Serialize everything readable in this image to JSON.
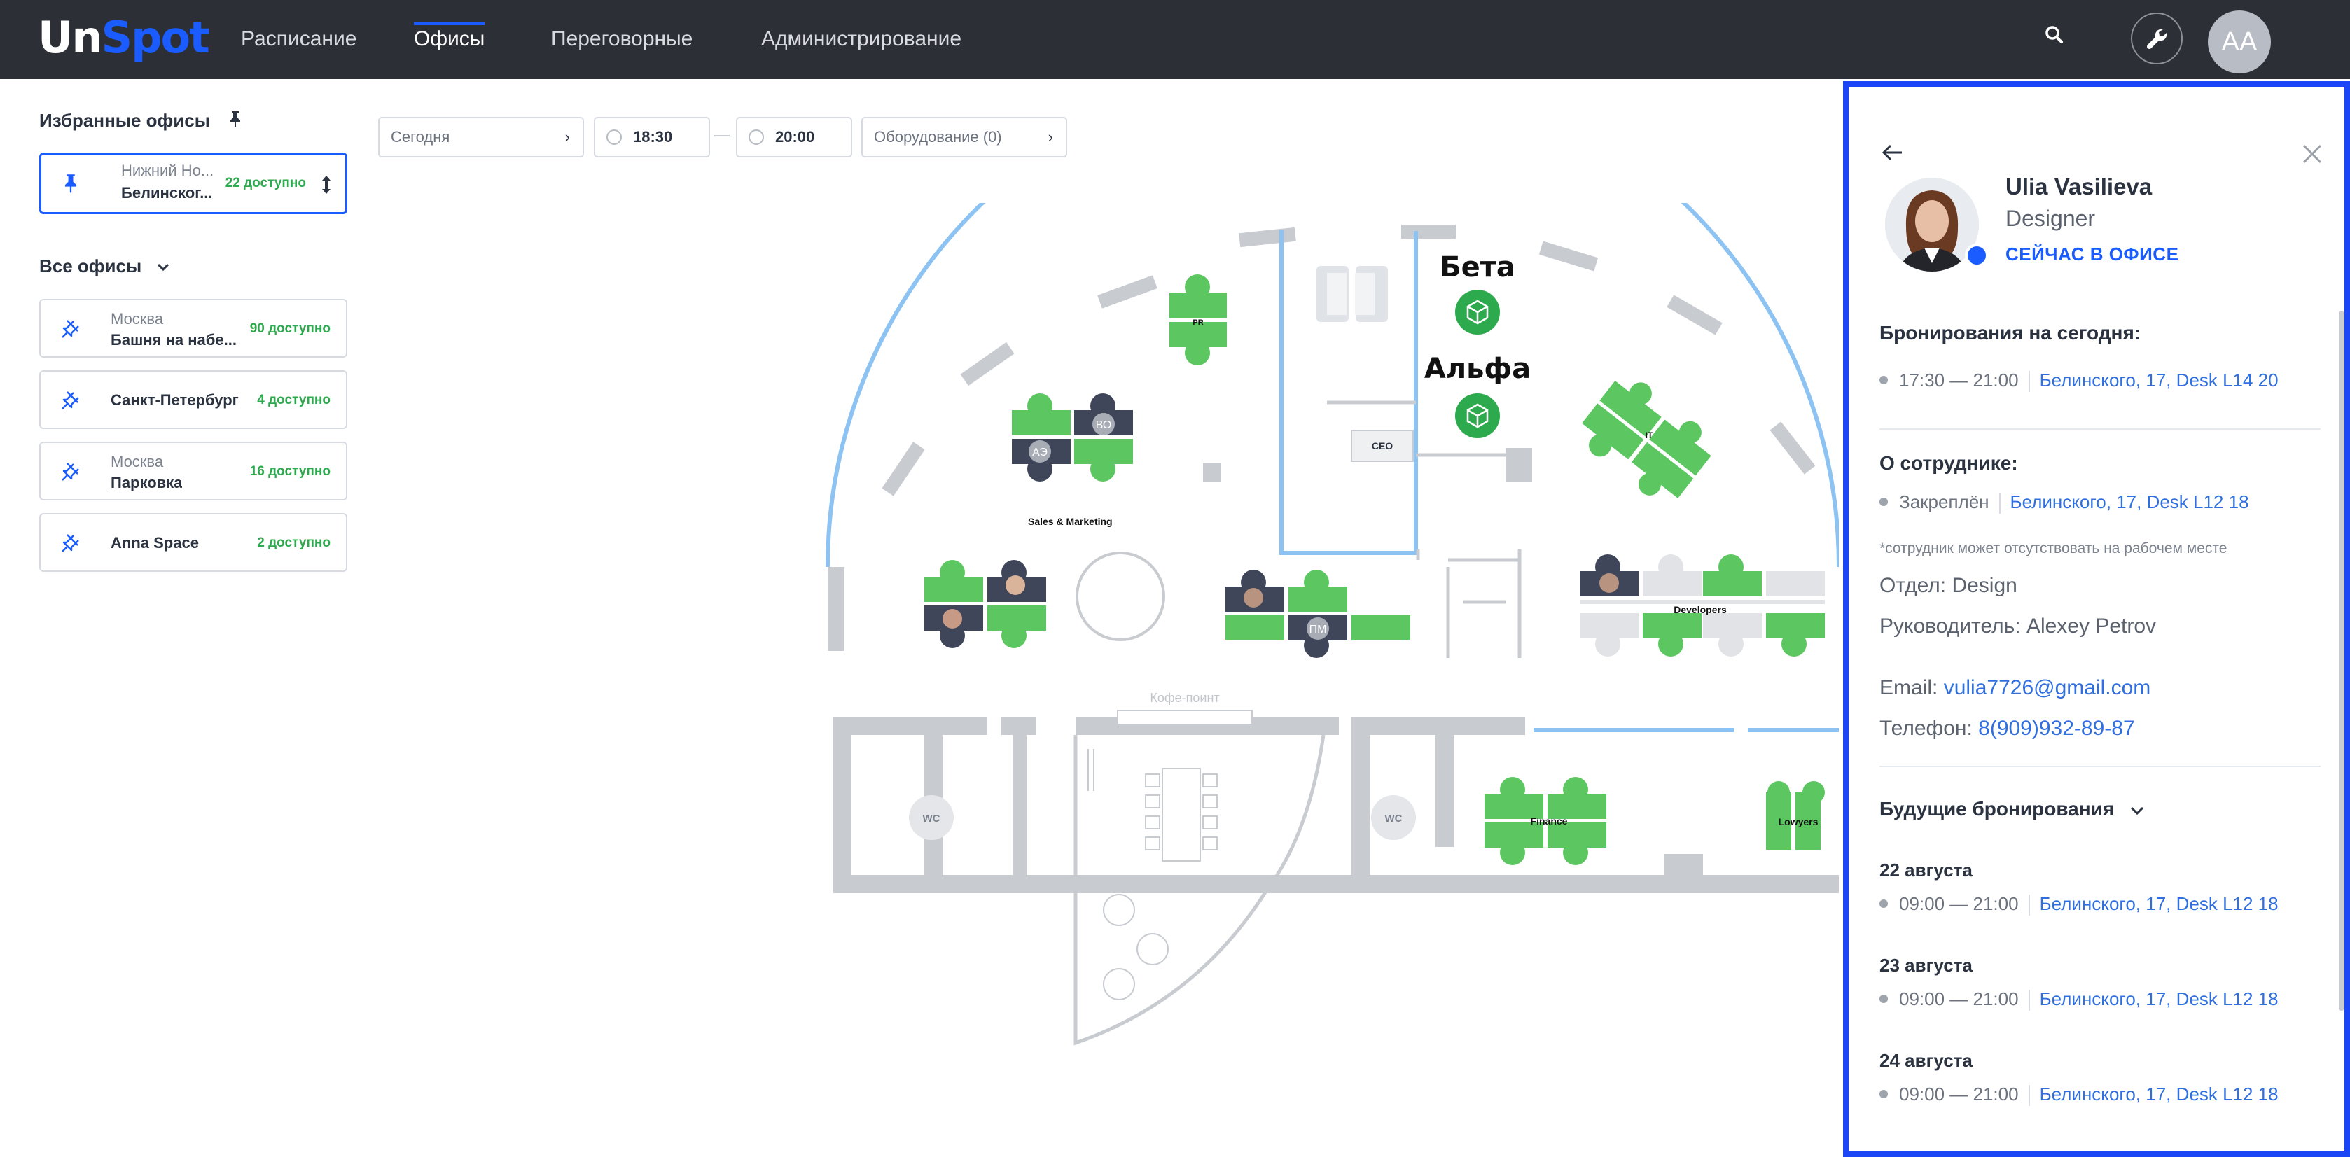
{
  "app": {
    "logo_un": "Un",
    "logo_spot": "Spot",
    "colors": {
      "accent": "#1a5cff",
      "topbar": "#2c2f36",
      "available": "#2eaa4e",
      "desk_free": "#5cc760",
      "desk_taken": "#3f4659",
      "wall": "#c8ccd1",
      "glass": "#8cc3f2",
      "panel_border": "#1a46f5"
    }
  },
  "nav": {
    "items": [
      {
        "label": "Расписание"
      },
      {
        "label": "Офисы"
      },
      {
        "label": "Переговорные"
      },
      {
        "label": "Администрирование"
      }
    ],
    "active_index": 1,
    "user_initials": "AA",
    "icons": {
      "search": "search-icon",
      "tools": "wrench-icon"
    }
  },
  "sidebar": {
    "favorites_title": "Избранные офисы",
    "favorites": [
      {
        "city": "Нижний Но...",
        "name": "Белинског...",
        "available": "22 доступно"
      }
    ],
    "all_title": "Все офисы",
    "offices": [
      {
        "city": "Москва",
        "name": "Башня на набе...",
        "available": "90 доступно"
      },
      {
        "city": "",
        "name": "Санкт-Петербург",
        "available": "4 доступно"
      },
      {
        "city": "Москва",
        "name": "Парковка",
        "available": "16 доступно"
      },
      {
        "city": "",
        "name": "Anna Space",
        "available": "2 доступно"
      }
    ]
  },
  "filters": {
    "date": "Сегодня",
    "time_from": "18:30",
    "time_to": "20:00",
    "separator": "—",
    "equipment": "Оборудование (0)"
  },
  "map": {
    "rooms": {
      "beta": "Бета",
      "alpha": "Альфа",
      "coffee": "Кофе-поинт",
      "wc": "WC",
      "ceo": "CEO",
      "pr": "PR",
      "it": "IT",
      "sales": "Sales & Marketing",
      "developers": "Developers",
      "finance": "Finance",
      "lowyers": "Lowyers"
    },
    "desk_initials": {
      "bo": "ВО",
      "az": "АЭ",
      "pm": "ПМ"
    }
  },
  "profile": {
    "name": "Ulia Vasilieva",
    "role": "Designer",
    "status": "СЕЙЧАС В ОФИСЕ",
    "today_title": "Бронирования на сегодня:",
    "today": {
      "time": "17:30 — 21:00",
      "place": "Белинского, 17, Desk L14 20"
    },
    "about_title": "О сотруднике:",
    "pinned": {
      "label": "Закреплён",
      "place": "Белинского, 17, Desk L12 18"
    },
    "note": "*сотрудник может отсутствовать на рабочем месте",
    "department": "Отдел: Design",
    "manager": "Руководитель: Alexey Petrov",
    "email_label": "Email:",
    "email": "vulia7726@gmail.com",
    "phone_label": "Телефон:",
    "phone": "8(909)932-89-87",
    "future_title": "Будущие бронирования",
    "future": [
      {
        "date": "22 августа",
        "time": "09:00 — 21:00",
        "place": "Белинского, 17, Desk L12 18"
      },
      {
        "date": "23 августа",
        "time": "09:00 — 21:00",
        "place": "Белинского, 17, Desk L12 18"
      },
      {
        "date": "24 августа",
        "time": "09:00 — 21:00",
        "place": "Белинского, 17, Desk L12 18"
      }
    ]
  }
}
